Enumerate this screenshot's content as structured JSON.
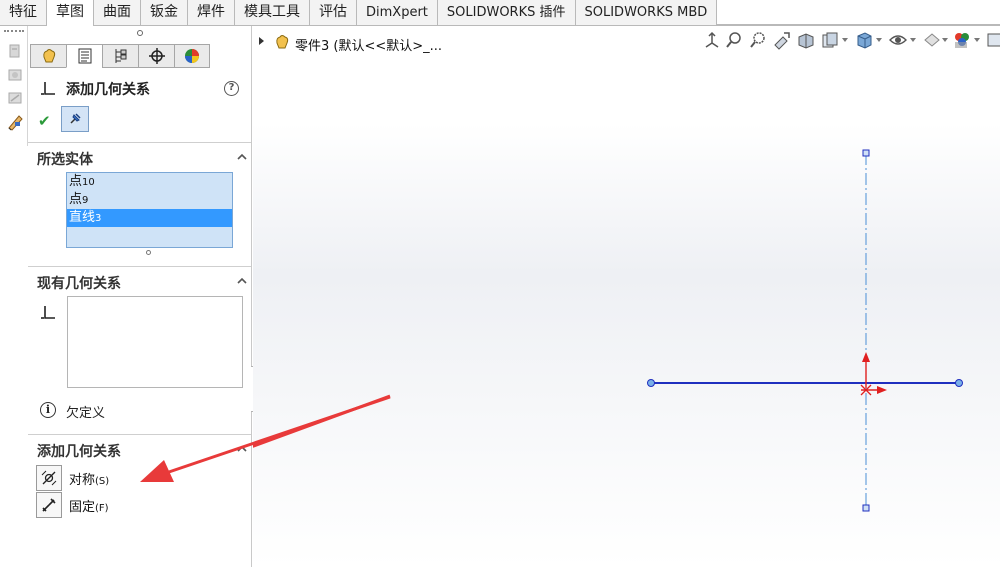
{
  "tabs": [
    {
      "label": "特征"
    },
    {
      "label": "草图",
      "active": true
    },
    {
      "label": "曲面"
    },
    {
      "label": "钣金"
    },
    {
      "label": "焊件"
    },
    {
      "label": "模具工具"
    },
    {
      "label": "评估"
    },
    {
      "label": "DimXpert"
    },
    {
      "label": "SOLIDWORKS 插件"
    },
    {
      "label": "SOLIDWORKS MBD"
    }
  ],
  "property_manager": {
    "tab_icons": [
      "feature-manager-icon",
      "property-manager-icon",
      "configuration-manager-icon",
      "dimxpert-manager-icon",
      "display-manager-icon"
    ],
    "title": "添加几何关系",
    "help_icon": "?",
    "selected_entities": {
      "title": "所选实体",
      "items": [
        {
          "name": "点",
          "sub": "10",
          "selected": false
        },
        {
          "name": "点",
          "sub": "9",
          "selected": false
        },
        {
          "name": "直线",
          "sub": "3",
          "selected": true
        }
      ]
    },
    "existing_relations": {
      "title": "现有几何关系",
      "status_icon": "i",
      "status": "欠定义"
    },
    "add_relations": {
      "title": "添加几何关系",
      "items": [
        {
          "label": "对称",
          "shortcut": "(S)",
          "icon": "symmetric-relation-icon"
        },
        {
          "label": "固定",
          "shortcut": "(F)",
          "icon": "fix-relation-icon"
        }
      ]
    }
  },
  "graphics": {
    "tree_text": "零件3  (默认<<默认>_...",
    "hud_icons": [
      "view-orientation-icon",
      "zoom-to-fit-icon",
      "zoom-to-area-icon",
      "previous-view-icon",
      "section-view-icon",
      "dynamic-annotation-icon",
      "view-orientation-box-icon",
      "display-style-icon",
      "hide-show-items-icon",
      "edit-appearance-icon",
      "apply-scene-icon",
      "view-settings-icon"
    ],
    "colors": {
      "sketch_line": "#1f2fbf",
      "centerline": "#4a8fd6",
      "origin": "#e02020",
      "arrow": "#e83a3a"
    }
  }
}
